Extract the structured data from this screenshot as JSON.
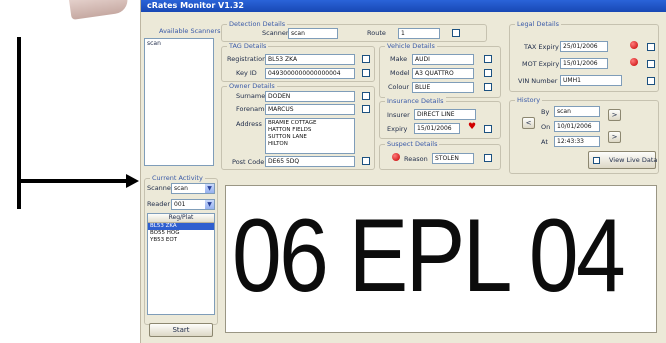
{
  "window": {
    "title": "cRates  Monitor V1.32"
  },
  "available_scanners": {
    "heading": "Available Scanners",
    "items": [
      "scan"
    ]
  },
  "detection": {
    "title": "Detection Details",
    "scanner_label": "Scanner",
    "scanner_value": "scan",
    "route_label": "Route",
    "route_value": "1"
  },
  "tag": {
    "title": "TAG Details",
    "registration_label": "Registration",
    "registration_value": "BL53 ZKA",
    "key_label": "Key ID",
    "key_value": "0493000000000000004"
  },
  "owner": {
    "title": "Owner Details",
    "surname_label": "Surname",
    "surname_value": "DODEN",
    "forename_label": "Forename",
    "forename_value": "MARCUS",
    "address_label": "Address",
    "address_lines": [
      "BRAMIE COTTAGE",
      "HATTON FIELDS",
      "SUTTON LANE",
      "HILTON"
    ],
    "postcode_label": "Post Code",
    "postcode_value": "DE65 5DQ"
  },
  "vehicle": {
    "title": "Vehicle Details",
    "make_label": "Make",
    "make_value": "AUDI",
    "model_label": "Model",
    "model_value": "A3 QUATTRO",
    "colour_label": "Colour",
    "colour_value": "BLUE"
  },
  "insurance": {
    "title": "Insurance Details",
    "insurer_label": "Insurer",
    "insurer_value": "DIRECT LINE",
    "expiry_label": "Expiry",
    "expiry_value": "15/01/2006"
  },
  "suspect": {
    "title": "Suspect Details",
    "reason_label": "Reason",
    "reason_value": "STOLEN"
  },
  "legal": {
    "title": "Legal Details",
    "tax_label": "TAX Expiry",
    "tax_value": "25/01/2006",
    "mot_label": "MOT Expiry",
    "mot_value": "15/01/2006",
    "vin_label": "VIN Number",
    "vin_value": "UMH1"
  },
  "history": {
    "title": "History",
    "by_label": "By",
    "by_value": "scan",
    "on_label": "On",
    "on_value": "10/01/2006",
    "at_label": "At",
    "at_value": "12:43:33",
    "prev_label": "<",
    "next_label": ">",
    "view_live_label": "View Live Data"
  },
  "current_activity": {
    "title": "Current Activity",
    "scanner_label": "Scanner",
    "scanner_value": "scan",
    "reader_label": "Reader",
    "reader_value": "001",
    "reg_header": "Reg/Plat",
    "reg_items": [
      "BL53 ZKA",
      "BO55 HOG",
      "YB53 EOT"
    ],
    "start_label": "Start"
  },
  "plate": {
    "text": "06 EPL 04"
  },
  "colors": {
    "accent": "#1848b4",
    "panel": "#ece9d8",
    "alert": "#c40000"
  }
}
